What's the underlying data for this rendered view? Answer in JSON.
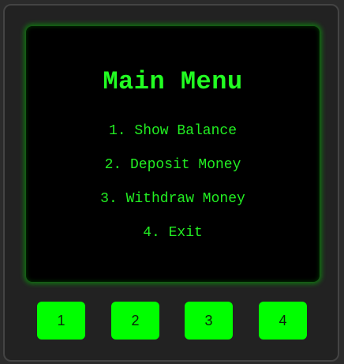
{
  "screen": {
    "title": "Main Menu",
    "menu_items": [
      {
        "label": "1. Show Balance"
      },
      {
        "label": "2. Deposit Money"
      },
      {
        "label": "3. Withdraw Money"
      },
      {
        "label": "4. Exit"
      }
    ]
  },
  "keypad": {
    "buttons": [
      {
        "label": "1"
      },
      {
        "label": "2"
      },
      {
        "label": "3"
      },
      {
        "label": "4"
      }
    ]
  },
  "colors": {
    "accent_green": "#00ff00",
    "screen_background": "#000000",
    "panel_background": "#222222"
  }
}
